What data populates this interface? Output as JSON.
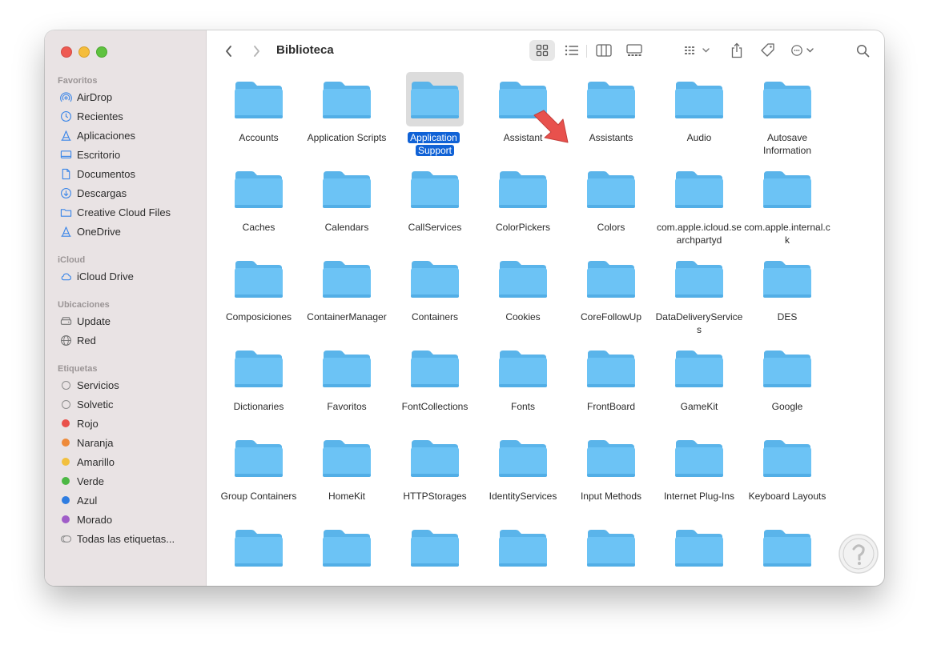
{
  "window": {
    "title": "Biblioteca"
  },
  "sidebar": {
    "favorites_heading": "Favoritos",
    "favorites": [
      {
        "label": "AirDrop",
        "icon": "airdrop-icon"
      },
      {
        "label": "Recientes",
        "icon": "clock-icon"
      },
      {
        "label": "Aplicaciones",
        "icon": "applications-icon"
      },
      {
        "label": "Escritorio",
        "icon": "desktop-icon"
      },
      {
        "label": "Documentos",
        "icon": "document-icon"
      },
      {
        "label": "Descargas",
        "icon": "download-icon"
      },
      {
        "label": "Creative Cloud Files",
        "icon": "folder-icon"
      },
      {
        "label": "OneDrive",
        "icon": "onedrive-icon"
      }
    ],
    "icloud_heading": "iCloud",
    "icloud": [
      {
        "label": "iCloud Drive",
        "icon": "cloud-icon"
      }
    ],
    "locations_heading": "Ubicaciones",
    "locations": [
      {
        "label": "Update",
        "icon": "disk-icon"
      },
      {
        "label": "Red",
        "icon": "network-icon"
      }
    ],
    "tags_heading": "Etiquetas",
    "tags": [
      {
        "label": "Servicios",
        "color": "hollow"
      },
      {
        "label": "Solvetic",
        "color": "hollow"
      },
      {
        "label": "Rojo",
        "color": "#e9504a"
      },
      {
        "label": "Naranja",
        "color": "#ee8a3a"
      },
      {
        "label": "Amarillo",
        "color": "#f2c03e"
      },
      {
        "label": "Verde",
        "color": "#4cb844"
      },
      {
        "label": "Azul",
        "color": "#2f7de1"
      },
      {
        "label": "Morado",
        "color": "#a05dc8"
      },
      {
        "label": "Todas las etiquetas...",
        "color": "all"
      }
    ]
  },
  "toolbar": {
    "back_icon": "chevron-left-icon",
    "forward_icon": "chevron-right-icon",
    "view_modes": [
      "grid-view-icon",
      "list-view-icon",
      "column-view-icon",
      "gallery-view-icon"
    ],
    "selected_view": "grid-view-icon"
  },
  "folders": [
    {
      "name": "Accounts",
      "selected": false
    },
    {
      "name": "Application Scripts",
      "selected": false
    },
    {
      "name": "Application Support",
      "selected": true
    },
    {
      "name": "Assistant",
      "selected": false
    },
    {
      "name": "Assistants",
      "selected": false
    },
    {
      "name": "Audio",
      "selected": false
    },
    {
      "name": "Autosave Information",
      "selected": false
    },
    {
      "name": "Caches",
      "selected": false
    },
    {
      "name": "Calendars",
      "selected": false
    },
    {
      "name": "CallServices",
      "selected": false
    },
    {
      "name": "ColorPickers",
      "selected": false
    },
    {
      "name": "Colors",
      "selected": false
    },
    {
      "name": "com.apple.icloud.searchpartyd",
      "selected": false
    },
    {
      "name": "com.apple.internal.ck",
      "selected": false
    },
    {
      "name": "Composiciones",
      "selected": false
    },
    {
      "name": "ContainerManager",
      "selected": false
    },
    {
      "name": "Containers",
      "selected": false
    },
    {
      "name": "Cookies",
      "selected": false
    },
    {
      "name": "CoreFollowUp",
      "selected": false
    },
    {
      "name": "DataDeliveryServices",
      "selected": false
    },
    {
      "name": "DES",
      "selected": false
    },
    {
      "name": "Dictionaries",
      "selected": false
    },
    {
      "name": "Favoritos",
      "selected": false
    },
    {
      "name": "FontCollections",
      "selected": false
    },
    {
      "name": "Fonts",
      "selected": false
    },
    {
      "name": "FrontBoard",
      "selected": false
    },
    {
      "name": "GameKit",
      "selected": false
    },
    {
      "name": "Google",
      "selected": false
    },
    {
      "name": "Group Containers",
      "selected": false
    },
    {
      "name": "HomeKit",
      "selected": false
    },
    {
      "name": "HTTPStorages",
      "selected": false
    },
    {
      "name": "IdentityServices",
      "selected": false
    },
    {
      "name": "Input Methods",
      "selected": false
    },
    {
      "name": "Internet Plug-Ins",
      "selected": false
    },
    {
      "name": "Keyboard Layouts",
      "selected": false
    },
    {
      "name": "",
      "selected": false
    },
    {
      "name": "",
      "selected": false
    },
    {
      "name": "",
      "selected": false
    },
    {
      "name": "",
      "selected": false
    },
    {
      "name": "",
      "selected": false
    },
    {
      "name": "",
      "selected": false
    },
    {
      "name": "",
      "selected": false
    }
  ],
  "colors": {
    "folder_body": "#6cc3f5",
    "folder_tab": "#5ab4ea",
    "selection": "#1062d6",
    "annotation_arrow": "#e8514d"
  }
}
